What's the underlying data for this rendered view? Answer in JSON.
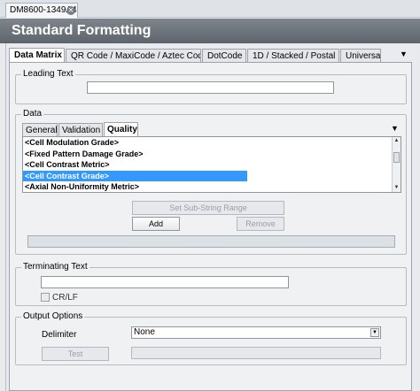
{
  "document_tab": {
    "title": "DM8600-1349A4"
  },
  "header": {
    "title": "Standard Formatting"
  },
  "tabs": [
    {
      "label": "Data Matrix"
    },
    {
      "label": "QR Code / MaxiCode / Aztec Code"
    },
    {
      "label": "DotCode"
    },
    {
      "label": "1D / Stacked / Postal"
    },
    {
      "label": "Universal"
    }
  ],
  "leading_text": {
    "label": "Leading Text",
    "value": ""
  },
  "data_group": {
    "label": "Data",
    "subtabs": [
      {
        "label": "General"
      },
      {
        "label": "Validation"
      },
      {
        "label": "Quality"
      }
    ],
    "list_items": [
      "<Cell Modulation Grade>",
      "<Fixed Pattern Damage Grade>",
      "<Cell Contrast Metric>",
      "<Cell Contrast Grade>",
      "<Axial Non-Uniformity Metric>"
    ],
    "selected_index": 3,
    "set_substring_label": "Set Sub-String Range",
    "add_label": "Add",
    "remove_label": "Remove",
    "preview_value": ""
  },
  "terminating_text": {
    "label": "Terminating Text",
    "value": "",
    "crlf_label": "CR/LF",
    "crlf_checked": false
  },
  "output_options": {
    "label": "Output Options",
    "delimiter_label": "Delimiter",
    "delimiter_value": "None",
    "test_label": "Test",
    "test_value": ""
  },
  "colors": {
    "selection": "#3399ff",
    "header": "#6b7178"
  },
  "icons": {
    "close": "close-icon",
    "dropdown": "chevron-down-icon"
  }
}
